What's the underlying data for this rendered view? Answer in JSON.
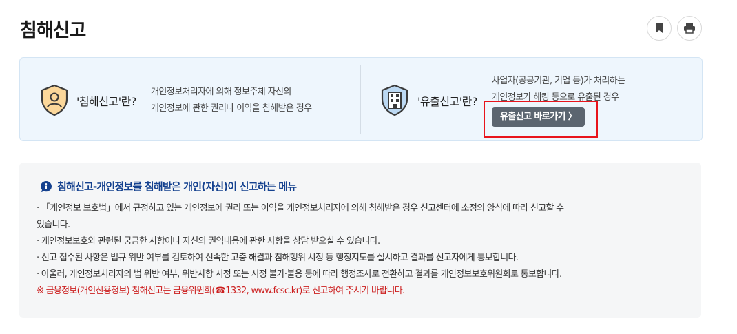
{
  "page": {
    "title": "침해신고"
  },
  "actions": {
    "bookmark_icon": "bookmark-icon",
    "print_icon": "printer-icon"
  },
  "definitions": {
    "infringement": {
      "term": "'침해신고'란?",
      "desc_line1": "개인정보처리자에 의해 정보주체 자신의",
      "desc_line2": "개인정보에 관한 권리나 이익을 침해받은 경우",
      "icon": "person-shield-icon"
    },
    "leak": {
      "term": "'유출신고'란?",
      "desc_line1": "사업자(공공기관, 기업 등)가 처리하는",
      "desc_line2": "개인정보가 해킹 등으로 유출된 경우",
      "icon": "building-shield-icon",
      "button_label": "유출신고 바로가기 〉"
    }
  },
  "notice": {
    "title": "침해신고-개인정보를 침해받은 개인(자신)이 신고하는 메뉴",
    "icon": "info-bubble-icon",
    "lines": [
      "· 「개인정보 보호법」에서 규정하고 있는 개인정보에 권리 또는 이익을 개인정보처리자에 의해 침해받은 경우 신고센터에 소정의 양식에 따라 신고할 수",
      "있습니다.",
      "· 개인정보보호와 관련된 궁금한 사항이나 자신의 권익내용에 관한 사항을 상담 받으실 수 있습니다.",
      "· 신고 접수된 사항은 법규 위반 여부를 검토하여 신속한 고충 해결과 침해행위 시정 등 행정지도를 실시하고 결과를 신고자에게 통보합니다.",
      "· 아울러, 개인정보처리자의 법 위반 여부, 위반사항 시정 또는 시정 불가·불응 등에 따라 행정조사로 전환하고 결과를 개인정보보호위원회로 통보합니다."
    ],
    "warning": "※ 금융정보(개인신용정보) 침해신고는 금융위원회(☎1332, www.fcsc.kr)로 신고하여 주시기 바랍니다."
  },
  "colors": {
    "accent_blue": "#14418f",
    "button_gray": "#5b6570",
    "warning_red": "#cc1f1f",
    "highlight_red": "#e8141c"
  }
}
